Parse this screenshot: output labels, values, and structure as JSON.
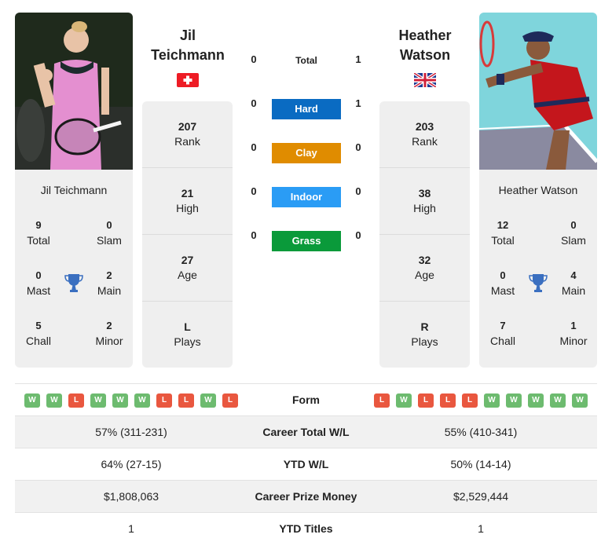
{
  "players": {
    "left": {
      "name_line1": "Jil",
      "name_line2": "Teichmann",
      "full_name": "Jil Teichmann",
      "country": "Switzerland",
      "flag_icon": "flag-switzerland-icon",
      "stats": [
        {
          "value": "207",
          "label": "Rank"
        },
        {
          "value": "21",
          "label": "High"
        },
        {
          "value": "27",
          "label": "Age"
        },
        {
          "value": "L",
          "label": "Plays"
        }
      ],
      "titles": {
        "total": {
          "value": "9",
          "label": "Total"
        },
        "slam": {
          "value": "0",
          "label": "Slam"
        },
        "mast": {
          "value": "0",
          "label": "Mast"
        },
        "main": {
          "value": "2",
          "label": "Main"
        },
        "chall": {
          "value": "5",
          "label": "Chall"
        },
        "minor": {
          "value": "2",
          "label": "Minor"
        }
      },
      "form": [
        "W",
        "W",
        "L",
        "W",
        "W",
        "W",
        "L",
        "L",
        "W",
        "L"
      ]
    },
    "right": {
      "name_line1": "Heather",
      "name_line2": "Watson",
      "full_name": "Heather Watson",
      "country": "Great Britain",
      "flag_icon": "flag-uk-icon",
      "stats": [
        {
          "value": "203",
          "label": "Rank"
        },
        {
          "value": "38",
          "label": "High"
        },
        {
          "value": "32",
          "label": "Age"
        },
        {
          "value": "R",
          "label": "Plays"
        }
      ],
      "titles": {
        "total": {
          "value": "12",
          "label": "Total"
        },
        "slam": {
          "value": "0",
          "label": "Slam"
        },
        "mast": {
          "value": "0",
          "label": "Mast"
        },
        "main": {
          "value": "4",
          "label": "Main"
        },
        "chall": {
          "value": "7",
          "label": "Chall"
        },
        "minor": {
          "value": "1",
          "label": "Minor"
        }
      },
      "form": [
        "L",
        "W",
        "L",
        "L",
        "L",
        "W",
        "W",
        "W",
        "W",
        "W"
      ]
    }
  },
  "h2h": [
    {
      "label": "Total",
      "left": "0",
      "right": "1",
      "color": null
    },
    {
      "label": "Hard",
      "left": "0",
      "right": "1",
      "color": "#0a6bc2"
    },
    {
      "label": "Clay",
      "left": "0",
      "right": "0",
      "color": "#e08c00"
    },
    {
      "label": "Indoor",
      "left": "0",
      "right": "0",
      "color": "#2a9cf5"
    },
    {
      "label": "Grass",
      "left": "0",
      "right": "0",
      "color": "#0a9a3a"
    }
  ],
  "comparison": {
    "form_label": "Form",
    "rows": [
      {
        "label": "Career Total W/L",
        "left": "57% (311-231)",
        "right": "55% (410-341)"
      },
      {
        "label": "YTD W/L",
        "left": "64% (27-15)",
        "right": "50% (14-14)"
      },
      {
        "label": "Career Prize Money",
        "left": "$1,808,063",
        "right": "$2,529,444"
      },
      {
        "label": "YTD Titles",
        "left": "1",
        "right": "1"
      }
    ]
  },
  "colors": {
    "win": "#6dbb6f",
    "loss": "#e9573f",
    "trophy": "#3a6fc0"
  }
}
